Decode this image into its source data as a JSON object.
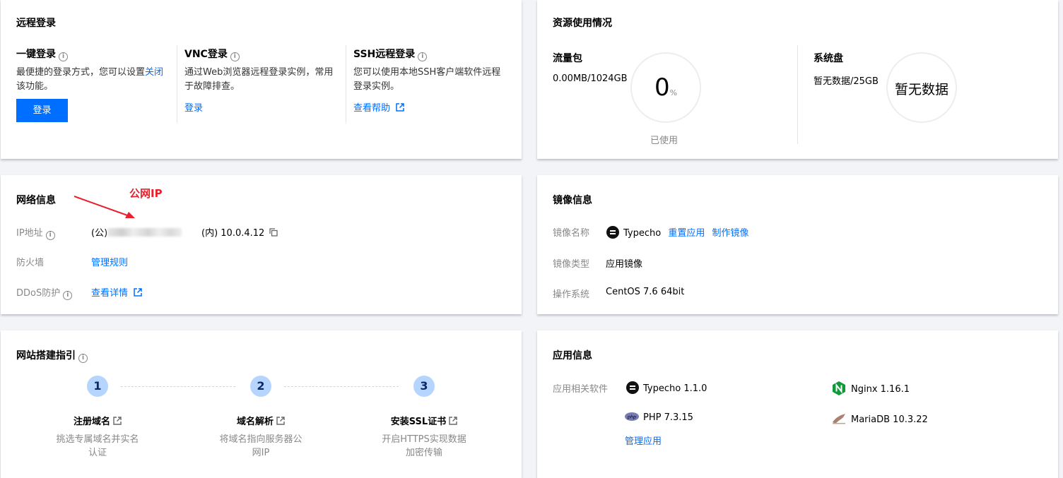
{
  "remote_login": {
    "title": "远程登录",
    "one_click": {
      "title": "一键登录",
      "desc_prefix": "最便捷的登录方式，您可以设置",
      "desc_link": "关闭",
      "desc_suffix": "该功能。",
      "button": "登录"
    },
    "vnc": {
      "title": "VNC登录",
      "desc": "通过Web浏览器远程登录实例，常用于故障排查。",
      "link": "登录"
    },
    "ssh": {
      "title": "SSH远程登录",
      "desc": "您可以使用本地SSH客户端软件远程登录实例。",
      "link": "查看帮助"
    }
  },
  "resource": {
    "title": "资源使用情况",
    "traffic": {
      "title": "流量包",
      "usage": "0.00MB/1024GB",
      "percent": "0",
      "percent_unit": "%",
      "caption": "已使用"
    },
    "disk": {
      "title": "系统盘",
      "usage": "暂无数据/25GB",
      "ring_text": "暂无数据"
    }
  },
  "network": {
    "title": "网络信息",
    "annotation": "公网IP",
    "ip_label": "IP地址",
    "ip_public_prefix": "(公)",
    "ip_private": "(内) 10.0.4.12",
    "firewall_label": "防火墙",
    "firewall_link": "管理规则",
    "ddos_label": "DDoS防护",
    "ddos_link": "查看详情"
  },
  "image": {
    "title": "镜像信息",
    "name_label": "镜像名称",
    "name_value": "Typecho",
    "reset_link": "重置应用",
    "make_link": "制作镜像",
    "type_label": "镜像类型",
    "type_value": "应用镜像",
    "os_label": "操作系统",
    "os_value": "CentOS 7.6 64bit"
  },
  "guide": {
    "title": "网站搭建指引",
    "steps": [
      {
        "num": "1",
        "title": "注册域名",
        "desc": "挑选专属域名并实名认证"
      },
      {
        "num": "2",
        "title": "域名解析",
        "desc": "将域名指向服务器公网IP"
      },
      {
        "num": "3",
        "title": "安装SSL证书",
        "desc": "开启HTTPS实现数据加密传输"
      }
    ]
  },
  "app_info": {
    "title": "应用信息",
    "label": "应用相关软件",
    "software": [
      {
        "name": "Typecho 1.1.0",
        "icon": "typecho-icon"
      },
      {
        "name": "Nginx 1.16.1",
        "icon": "nginx-icon"
      },
      {
        "name": "PHP 7.3.15",
        "icon": "php-icon"
      },
      {
        "name": "MariaDB 10.3.22",
        "icon": "mariadb-icon"
      }
    ],
    "manage_link": "管理应用"
  },
  "colors": {
    "accent": "#006eff",
    "annotation": "#e8212d",
    "background": "#f3f4f7"
  }
}
